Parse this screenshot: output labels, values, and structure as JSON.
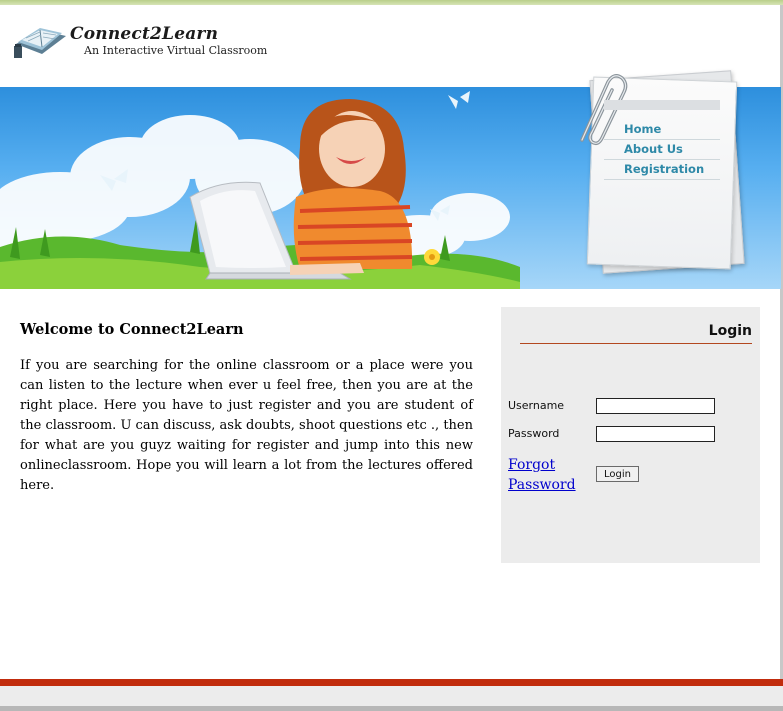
{
  "brand": {
    "name": "Connect2Learn",
    "tagline": "An Interactive Virtual Classroom"
  },
  "nav": {
    "items": [
      {
        "label": "Home"
      },
      {
        "label": "About Us"
      },
      {
        "label": "Registration"
      }
    ]
  },
  "welcome": {
    "title": "Welcome to Connect2Learn",
    "text": "If you are searching for the online classroom or a place were you can listen to the lecture when ever u feel free, then you are at the right place. Here you have to just register and you are student of the classroom. U can discuss, ask doubts, shoot questions etc ., then for what are you guyz waiting for register and jump into this new onlineclassroom. Hope you will learn a lot from the lectures offered here."
  },
  "login": {
    "title": "Login",
    "username_label": "Username",
    "username_value": "",
    "password_label": "Password",
    "password_value": "",
    "forgot_label": "Forgot Password",
    "button_label": "Login"
  },
  "colors": {
    "accent_rule": "#b3471f",
    "footer_bar": "#c12c0d",
    "nav_link": "#2e89a8",
    "login_bg": "#ececec"
  }
}
